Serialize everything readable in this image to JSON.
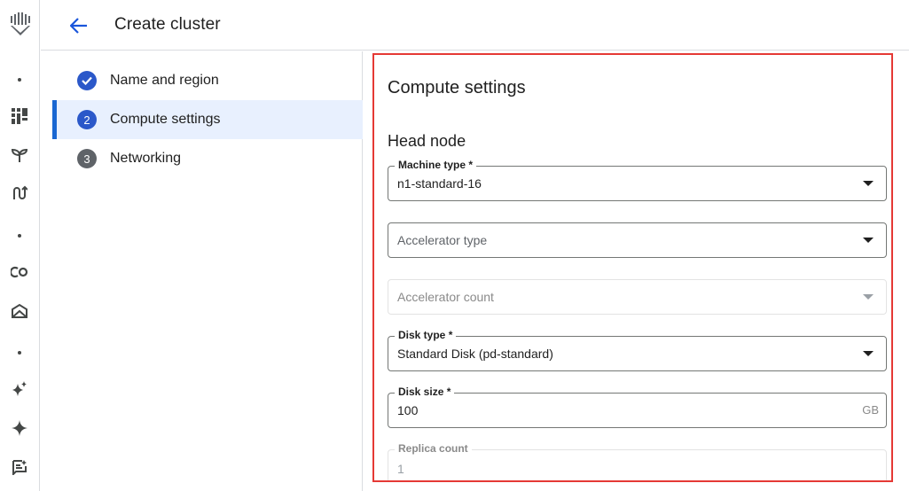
{
  "rail": {
    "items": [
      {
        "icon": "vertex-ai-logo-icon"
      },
      {
        "icon": "dashboard-icon"
      },
      {
        "icon": "sprout-icon"
      },
      {
        "icon": "pipeline-icon"
      },
      {
        "icon": "colab-icon"
      },
      {
        "icon": "model-garden-icon"
      },
      {
        "icon": "sparkle-plus-icon"
      },
      {
        "icon": "sparkle-icon"
      },
      {
        "icon": "prompt-notes-icon"
      }
    ]
  },
  "header": {
    "title": "Create cluster"
  },
  "stepper": {
    "steps": [
      {
        "number": "",
        "label": "Name and region",
        "state": "done"
      },
      {
        "number": "2",
        "label": "Compute settings",
        "state": "current"
      },
      {
        "number": "3",
        "label": "Networking",
        "state": "todo"
      }
    ]
  },
  "compute": {
    "title": "Compute settings",
    "head_node_title": "Head node",
    "machine_type": {
      "label": "Machine type *",
      "value": "n1-standard-16"
    },
    "accelerator_type": {
      "placeholder": "Accelerator type"
    },
    "accelerator_count": {
      "placeholder": "Accelerator count"
    },
    "disk_type": {
      "label": "Disk type *",
      "value": "Standard Disk (pd-standard)"
    },
    "disk_size": {
      "label": "Disk size *",
      "value": "100",
      "unit": "GB"
    },
    "replica_count": {
      "label": "Replica count",
      "value": "1"
    }
  },
  "colors": {
    "accent": "#2b58c9",
    "highlight_border": "#e53935",
    "active_step_bg": "#e8f0fe"
  }
}
